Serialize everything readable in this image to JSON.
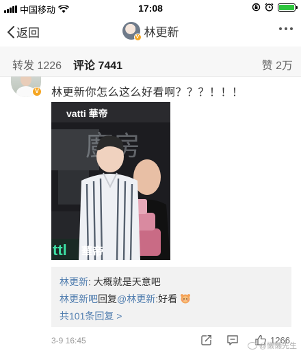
{
  "status_bar": {
    "carrier": "中国移动",
    "time": "17:08",
    "battery_color": "#2ec53d"
  },
  "nav": {
    "back_label": "返回",
    "title": "林更新",
    "verified_badge": "V"
  },
  "tabs": {
    "repost_label": "转发",
    "repost_count": "1226",
    "comments_label": "评论",
    "comments_count": "7441",
    "likes_label": "赞",
    "likes_count": "2万"
  },
  "comment": {
    "verified_badge": "V",
    "text": "林更新你怎么这么好看啊？？？！！！",
    "image": {
      "brand_text": "vatti 華帝",
      "caption_brand": "華帝",
      "background_word": "廚房"
    },
    "replies": [
      {
        "user": "林更新",
        "text": ": 大概就是天意吧"
      },
      {
        "user": "林更新吧",
        "middle": "回复",
        "target": "@林更新",
        "text": ":好看",
        "emoji": "blushing-face-emoji"
      }
    ],
    "more_replies": "共101条回复 >",
    "timestamp": "3-9 16:45",
    "like_count": "1266"
  },
  "watermark": {
    "text": "@懒懒先生"
  },
  "colors": {
    "link": "#507daf",
    "verified": "#f5a623",
    "tab_bg": "#f7f7f7",
    "reply_bg": "#f2f2f2"
  }
}
